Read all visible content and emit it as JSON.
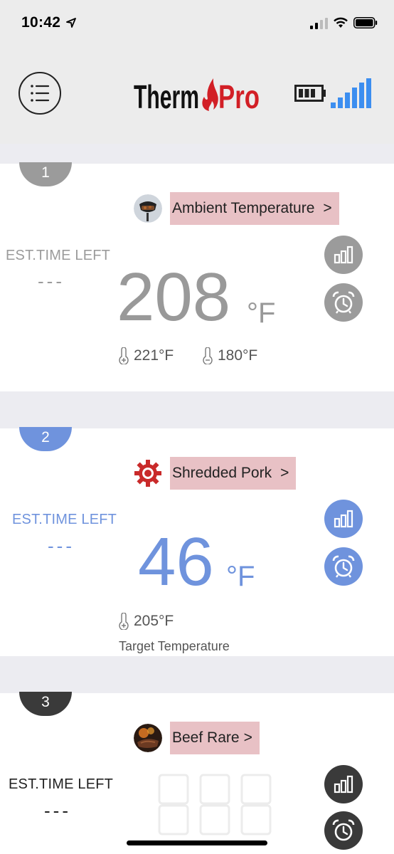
{
  "status_bar": {
    "time": "10:42"
  },
  "header": {
    "logo_text_left": "Therm",
    "logo_text_right": "Pro",
    "accent_red": "#d21f26",
    "signal_color": "#3c8ef0"
  },
  "probes": [
    {
      "number": "1",
      "food_label": "Ambient Temperature",
      "chevron": ">",
      "est_label": "EST.TIME LEFT",
      "est_value": "---",
      "temperature": "208",
      "unit": "°F",
      "high_temp": "221°F",
      "low_temp": "180°F",
      "color": "#9b9b9b"
    },
    {
      "number": "2",
      "food_label": "Shredded Pork",
      "chevron": ">",
      "est_label": "EST.TIME LEFT",
      "est_value": "---",
      "temperature": "46",
      "unit": "°F",
      "target_temp": "205°F",
      "target_caption": "Target Temperature",
      "color": "#6f93dd"
    },
    {
      "number": "3",
      "food_label": "Beef Rare",
      "chevron": ">",
      "est_label": "EST.TIME LEFT",
      "est_value": "---",
      "temperature_placeholder": "888",
      "color": "#3a3a3a"
    }
  ]
}
